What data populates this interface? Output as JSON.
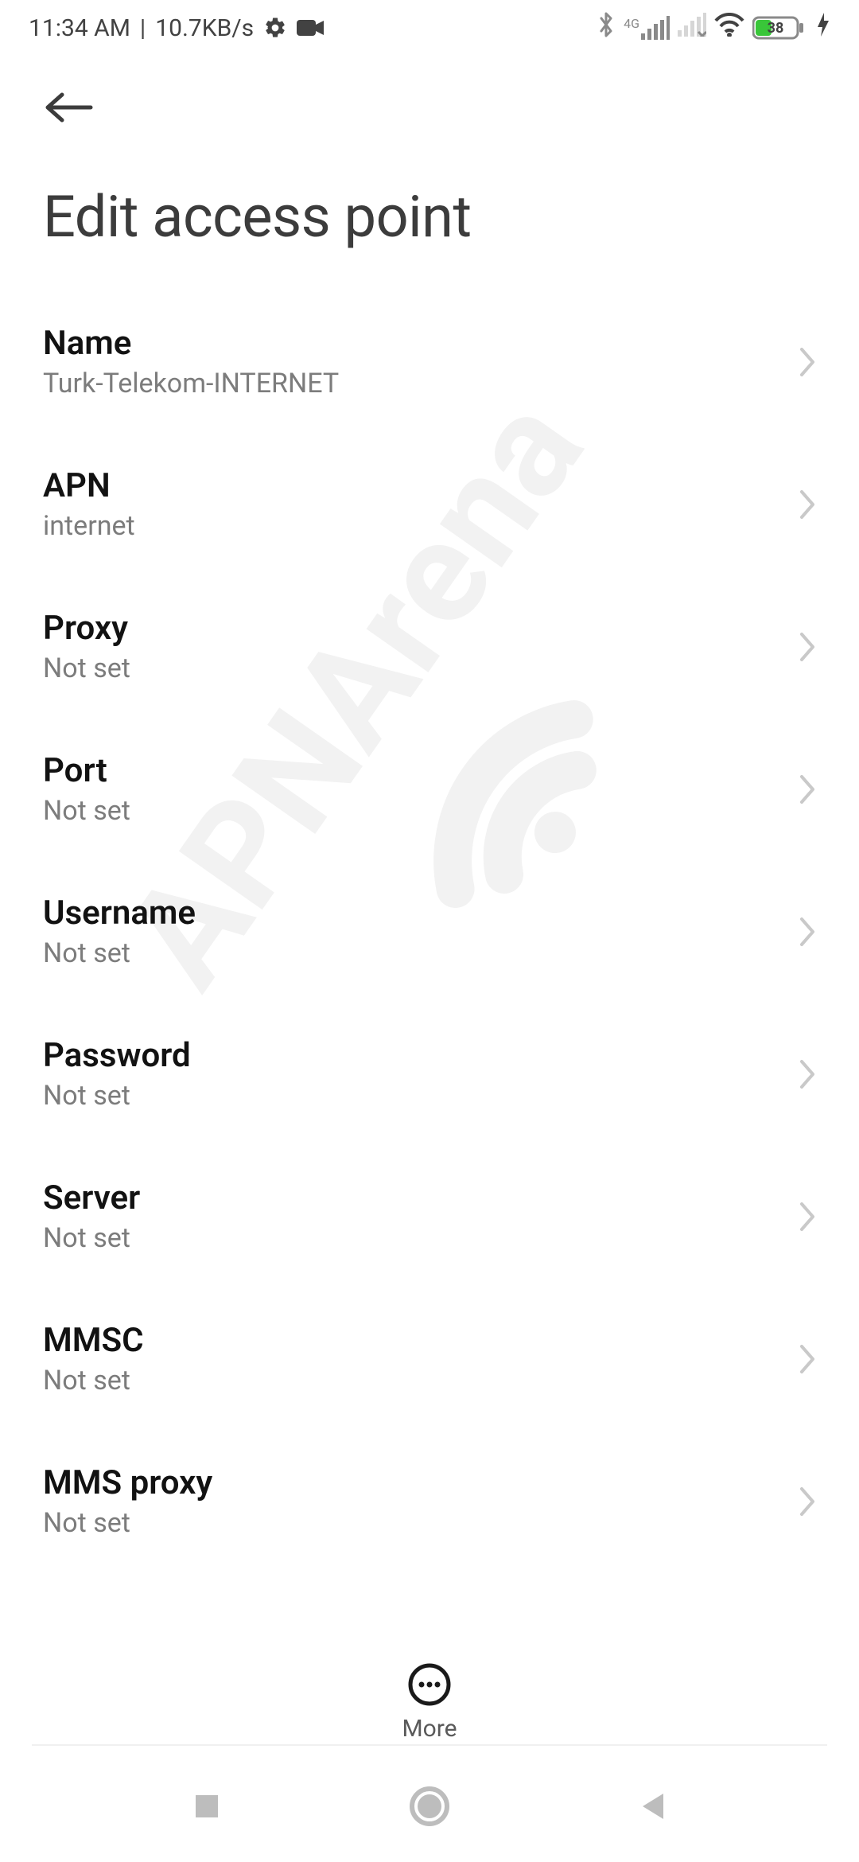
{
  "status": {
    "time": "11:34 AM",
    "speed": "10.7KB/s",
    "network_label": "4G",
    "battery_percent": "38"
  },
  "page": {
    "title": "Edit access point"
  },
  "items": [
    {
      "title": "Name",
      "value": "Turk-Telekom-INTERNET"
    },
    {
      "title": "APN",
      "value": "internet"
    },
    {
      "title": "Proxy",
      "value": "Not set"
    },
    {
      "title": "Port",
      "value": "Not set"
    },
    {
      "title": "Username",
      "value": "Not set"
    },
    {
      "title": "Password",
      "value": "Not set"
    },
    {
      "title": "Server",
      "value": "Not set"
    },
    {
      "title": "MMSC",
      "value": "Not set"
    },
    {
      "title": "MMS proxy",
      "value": "Not set"
    }
  ],
  "more": {
    "label": "More"
  },
  "watermark": {
    "text": "APNArena"
  }
}
